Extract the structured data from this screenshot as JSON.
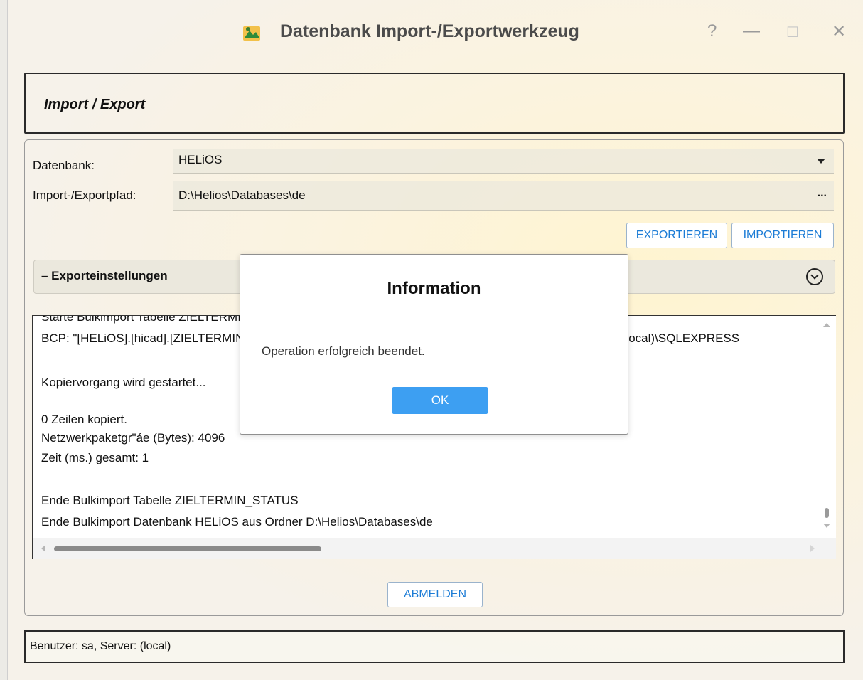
{
  "window": {
    "title": "Datenbank Import-/Exportwerkzeug",
    "help_glyph": "?",
    "minimize_glyph": "—",
    "maximize_glyph": "☐",
    "close_glyph": "✕"
  },
  "header": {
    "title": "Import / Export"
  },
  "form": {
    "database_label": "Datenbank:",
    "database_value": "HELiOS",
    "path_label": "Import-/Exportpfad:",
    "path_value": "D:\\Helios\\Databases\\de",
    "browse_label": "..."
  },
  "actions": {
    "export_label": "EXPORTIEREN",
    "import_label": "IMPORTIEREN"
  },
  "export_settings": {
    "title": "– Exporteinstellungen"
  },
  "log": {
    "lines": [
      "Starte Bulkimport Tabelle ZIELTERMIN_STATUS",
      "BCP: \"[HELiOS].[hicad].[ZIELTERMIN_STATUS]\" in \"D:\\Helios\\Databases\\de\\ZIELTERMIN_STATUS.dat\" -S (local)\\SQLEXPRESS",
      "Kopiervorgang wird gestartet...",
      "0 Zeilen kopiert.",
      "Netzwerkpaketgr\"áe (Bytes): 4096",
      "Zeit (ms.) gesamt: 1",
      "Ende Bulkimport Tabelle ZIELTERMIN_STATUS",
      "Ende Bulkimport Datenbank HELiOS aus Ordner D:\\Helios\\Databases\\de"
    ]
  },
  "footer": {
    "logout_label": "ABMELDEN"
  },
  "status": {
    "text": "Benutzer: sa, Server: (local)"
  },
  "dialog": {
    "title": "Information",
    "message": "Operation erfolgreich beendet.",
    "ok_label": "OK"
  },
  "colors": {
    "accent": "#3d9ff2",
    "link": "#1c7cd6"
  }
}
